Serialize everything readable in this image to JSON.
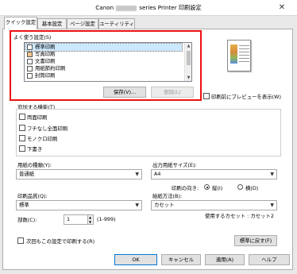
{
  "window": {
    "title_prefix": "Canon",
    "title_suffix": "series Printer 印刷設定",
    "close_glyph": "✕"
  },
  "tabs": [
    {
      "label": "クイック設定",
      "active": true
    },
    {
      "label": "基本設定",
      "active": false
    },
    {
      "label": "ページ設定",
      "active": false
    },
    {
      "label": "ユーティリティ",
      "active": false
    }
  ],
  "favorites": {
    "label": "よく使う設定(S)",
    "items": [
      "標準印刷",
      "写真印刷",
      "文書印刷",
      "用紙節約印刷",
      "封筒印刷"
    ],
    "selected_index": 0,
    "save_label": "保存(V)...",
    "delete_label": "削除(L)"
  },
  "preview": {
    "checkbox_label": "印刷前にプレビューを表示(W)"
  },
  "additional": {
    "label": "追加する機能(T)",
    "options": [
      "両面印刷",
      "フチなし全面印刷",
      "モノクロ印刷",
      "下書き"
    ]
  },
  "media_type": {
    "label": "用紙の種類(Y):",
    "value": "普通紙"
  },
  "paper_size": {
    "label": "出力用紙サイズ(E):",
    "value": "A4"
  },
  "orientation": {
    "label": "印刷の向き:",
    "portrait": "縦(I)",
    "landscape": "横(D)",
    "selected": "portrait"
  },
  "print_quality": {
    "label": "印刷品質(Q):",
    "value": "標準"
  },
  "paper_source": {
    "label": "給紙方法(B):",
    "value": "カセット",
    "note": "使用するカセット : カセット2"
  },
  "copies": {
    "label": "部数(C):",
    "value": "1",
    "range": "(1-999)"
  },
  "footer": {
    "always_print_label": "次回もこの設定で印刷する(R)",
    "defaults_label": "標準に戻す(F)",
    "ok": "OK",
    "cancel": "キャンセル",
    "apply": "適用(A)",
    "help": "ヘルプ"
  },
  "colors": {
    "highlight": "#e11111",
    "selection": "#cce8ff",
    "accent": "#0078d7"
  }
}
